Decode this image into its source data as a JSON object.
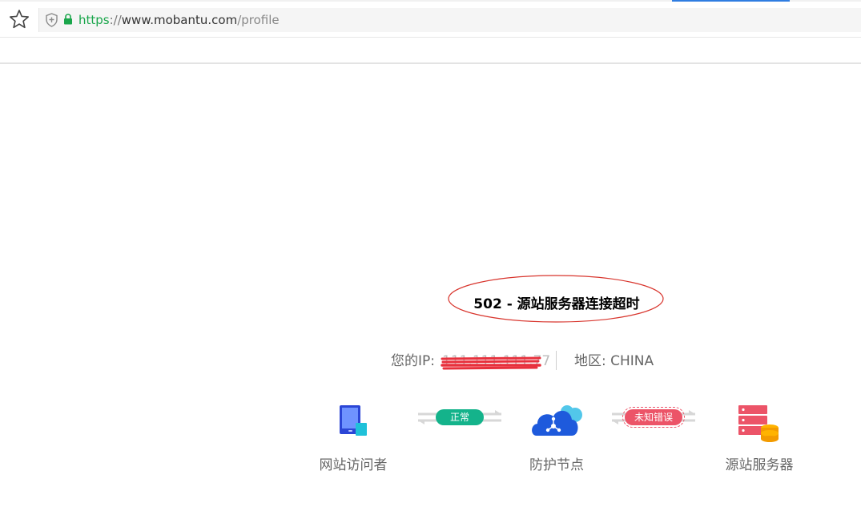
{
  "browser": {
    "url": {
      "scheme": "https",
      "separator": "://",
      "host": "www.mobantu.com",
      "path": "/profile"
    },
    "colors": {
      "secure": "#1aa64b",
      "active_tab": "#2f7de1"
    }
  },
  "error": {
    "title": "502 - 源站服务器连接超时",
    "ip_label": "您的IP:",
    "ip_value": "111.111.111.77",
    "region_label": "地区: CHINA"
  },
  "flow": {
    "nodes": [
      {
        "label": "网站访问者",
        "icon": "tablet-icon"
      },
      {
        "label": "防护节点",
        "icon": "cloud-node-icon"
      },
      {
        "label": "源站服务器",
        "icon": "server-database-icon"
      }
    ],
    "links": [
      {
        "status": "正常",
        "color": "#14b38b"
      },
      {
        "status": "未知错误",
        "color": "#ec5468"
      }
    ]
  },
  "annotation_color": "#d8342c"
}
